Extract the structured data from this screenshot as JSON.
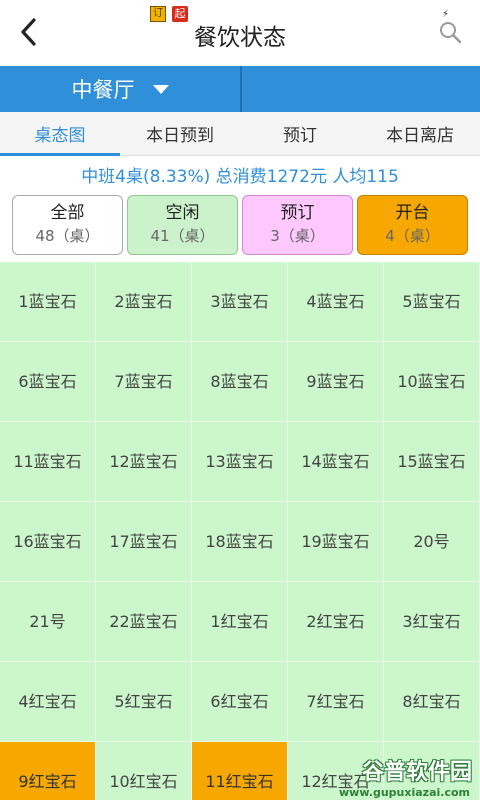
{
  "header": {
    "title": "餐饮状态",
    "badge_a": "订",
    "badge_b": "起",
    "flash_icon": "⚡",
    "back_icon": "chevron-left-icon",
    "search_icon": "search-icon"
  },
  "bluebar": {
    "room": "中餐厅"
  },
  "tabs": [
    {
      "label": "桌态图"
    },
    {
      "label": "本日预到"
    },
    {
      "label": "预订"
    },
    {
      "label": "本日离店"
    }
  ],
  "summary": "中班4桌(8.33%) 总消费1272元 人均115",
  "statuses": [
    {
      "name": "全部",
      "count": "48（桌）"
    },
    {
      "name": "空闲",
      "count": "41（桌）"
    },
    {
      "name": "预订",
      "count": "3（桌）"
    },
    {
      "name": "开台",
      "count": "4（桌）"
    }
  ],
  "colors": {
    "accent": "#2f8fd8",
    "free": "#ccf7cc",
    "reserved": "#ffc8ff",
    "open": "#f6a800"
  },
  "tables": [
    "1蓝宝石",
    "2蓝宝石",
    "3蓝宝石",
    "4蓝宝石",
    "5蓝宝石",
    "6蓝宝石",
    "7蓝宝石",
    "8蓝宝石",
    "9蓝宝石",
    "10蓝宝石",
    "11蓝宝石",
    "12蓝宝石",
    "13蓝宝石",
    "14蓝宝石",
    "15蓝宝石",
    "16蓝宝石",
    "17蓝宝石",
    "18蓝宝石",
    "19蓝宝石",
    "20号",
    "21号",
    "22蓝宝石",
    "1红宝石",
    "2红宝石",
    "3红宝石",
    "4红宝石",
    "5红宝石",
    "6红宝石",
    "7红宝石",
    "8红宝石",
    "9红宝石",
    "10红宝石",
    "11红宝石",
    "12红宝石",
    ""
  ],
  "open_tables": [
    30,
    32
  ],
  "watermark": {
    "title": "谷普软件园",
    "url": "www.gupuxiazai.com"
  }
}
